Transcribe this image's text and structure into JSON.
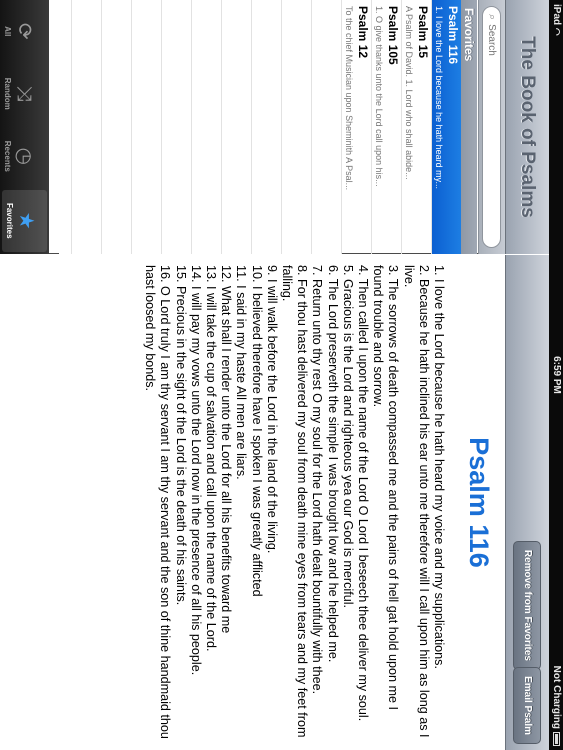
{
  "status_bar": {
    "device": "iPad",
    "time": "6:59 PM",
    "charging": "Not Charging"
  },
  "left_pane": {
    "nav_title": "The Book of Psalms",
    "search_placeholder": "Search",
    "section_header": "Favorites",
    "items": [
      {
        "title": "Psalm 116",
        "subtitle": "1. I love the Lord because he hath heard my...",
        "selected": true
      },
      {
        "title": "Psalm 15",
        "subtitle": "A Psalm of David.   1. Lord who shall abide...",
        "selected": false
      },
      {
        "title": "Psalm 105",
        "subtitle": "1. O give thanks unto the Lord call upon his...",
        "selected": false
      },
      {
        "title": "Psalm 12",
        "subtitle": "To the chief Musician upon Sheminith A Psal...",
        "selected": false
      }
    ],
    "tabs": [
      {
        "label": "All",
        "icon": "refresh-icon"
      },
      {
        "label": "Random",
        "icon": "shuffle-icon"
      },
      {
        "label": "Recents",
        "icon": "clock-icon"
      },
      {
        "label": "Favorites",
        "icon": "star-icon",
        "active": true
      }
    ]
  },
  "right_pane": {
    "remove_button": "Remove from Favorites",
    "email_button": "Email Psalm",
    "psalm_title": "Psalm 116",
    "verses": [
      "1. I love the Lord because he hath heard my voice and my supplications.",
      "2. Because he hath inclined his ear unto me therefore will I call upon him as long as I live.",
      "3. The sorrows of death compassed me and the pains of hell gat hold upon me I found trouble and sorrow.",
      "4. Then called I upon the name of the Lord O Lord I beseech thee deliver my soul.",
      "5. Gracious is the Lord and righteous yea our God is merciful.",
      "6. The Lord preserveth the simple I was brought low and he helped me.",
      "7. Return unto thy rest O my soul for the Lord hath dealt bountifully with thee.",
      "8. For thou hast delivered my soul from death mine eyes from tears and my feet from falling.",
      "9. I will walk before the Lord in the land of the living.",
      "10. I believed therefore have I spoken I was greatly afflicted",
      "11. I said in my haste All men are liars.",
      "12. What shall I render unto the Lord for all his benefits toward me",
      "13. I will take the cup of salvation and call upon the name of the Lord.",
      "14. I will pay my vows unto the Lord now in the presence of all his people.",
      "15. Precious in the sight of the Lord is the death of his saints.",
      "16. O Lord truly I am thy servant I am thy servant and the son of thine handmaid thou hast loosed my bonds."
    ]
  }
}
